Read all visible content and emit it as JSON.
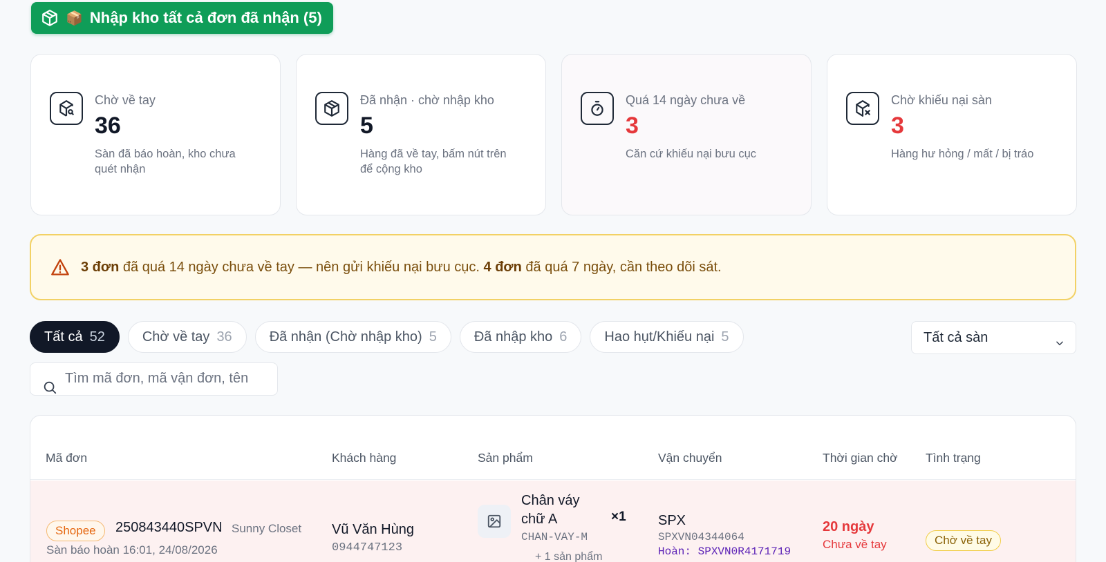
{
  "top_button": {
    "label": "Nhập kho tất cả đơn đã nhận (5)",
    "emoji": "📦"
  },
  "stats": [
    {
      "label": "Chờ về tay",
      "value": "36",
      "desc": "Sàn đã báo hoàn, kho chưa quét nhận",
      "icon": "package-search-icon"
    },
    {
      "label": "Đã nhận · chờ nhập kho",
      "value": "5",
      "desc": "Hàng đã về tay, bấm nút trên để cộng kho",
      "icon": "package-icon"
    },
    {
      "label": "Quá 14 ngày chưa về",
      "value": "3",
      "desc": "Căn cứ khiếu nại bưu cục",
      "icon": "timer-icon"
    },
    {
      "label": "Chờ khiếu nại sàn",
      "value": "3",
      "desc": "Hàng hư hỏng / mất / bị tráo",
      "icon": "package-x-icon"
    }
  ],
  "alert": {
    "count1": "3 đơn",
    "text1": " đã quá 14 ngày chưa về tay — nên gửi khiếu nại bưu cục. ",
    "count2": "4 đơn",
    "text2": " đã quá 7 ngày, cần theo dõi sát."
  },
  "tabs": [
    {
      "label": "Tất cả",
      "count": "52"
    },
    {
      "label": "Chờ về tay",
      "count": "36"
    },
    {
      "label": "Đã nhận (Chờ nhập kho)",
      "count": "5"
    },
    {
      "label": "Đã nhập kho",
      "count": "6"
    },
    {
      "label": "Hao hụt/Khiếu nại",
      "count": "5"
    }
  ],
  "platform_filter": {
    "selected": "Tất cả sàn"
  },
  "search": {
    "placeholder": "Tìm mã đơn, mã vận đơn, tên"
  },
  "table": {
    "headers": {
      "order": "Mã đơn",
      "customer": "Khách hàng",
      "product": "Sản phẩm",
      "shipping": "Vận chuyển",
      "wait": "Thời gian chờ",
      "status": "Tình trạng"
    },
    "rows": [
      {
        "platform": "Shopee",
        "order_id": "250843440SPVN",
        "shop": "Sunny Closet",
        "note": "Sàn báo hoàn 16:01, 24/08/2026",
        "customer_name": "Vũ Văn Hùng",
        "customer_phone": "0944747123",
        "product_line1": "Chân váy",
        "product_line2": "chữ A",
        "sku": "CHAN-VAY-M",
        "qty": "×1",
        "more": "+ 1 sản phẩm",
        "carrier": "SPX",
        "tracking": "SPXVN04344064",
        "return_label": "Hoàn:",
        "return_tracking": "SPXVN0R4171719",
        "wait_days": "20 ngày",
        "wait_note": "Chưa về tay",
        "status": "Chờ về tay"
      }
    ]
  }
}
